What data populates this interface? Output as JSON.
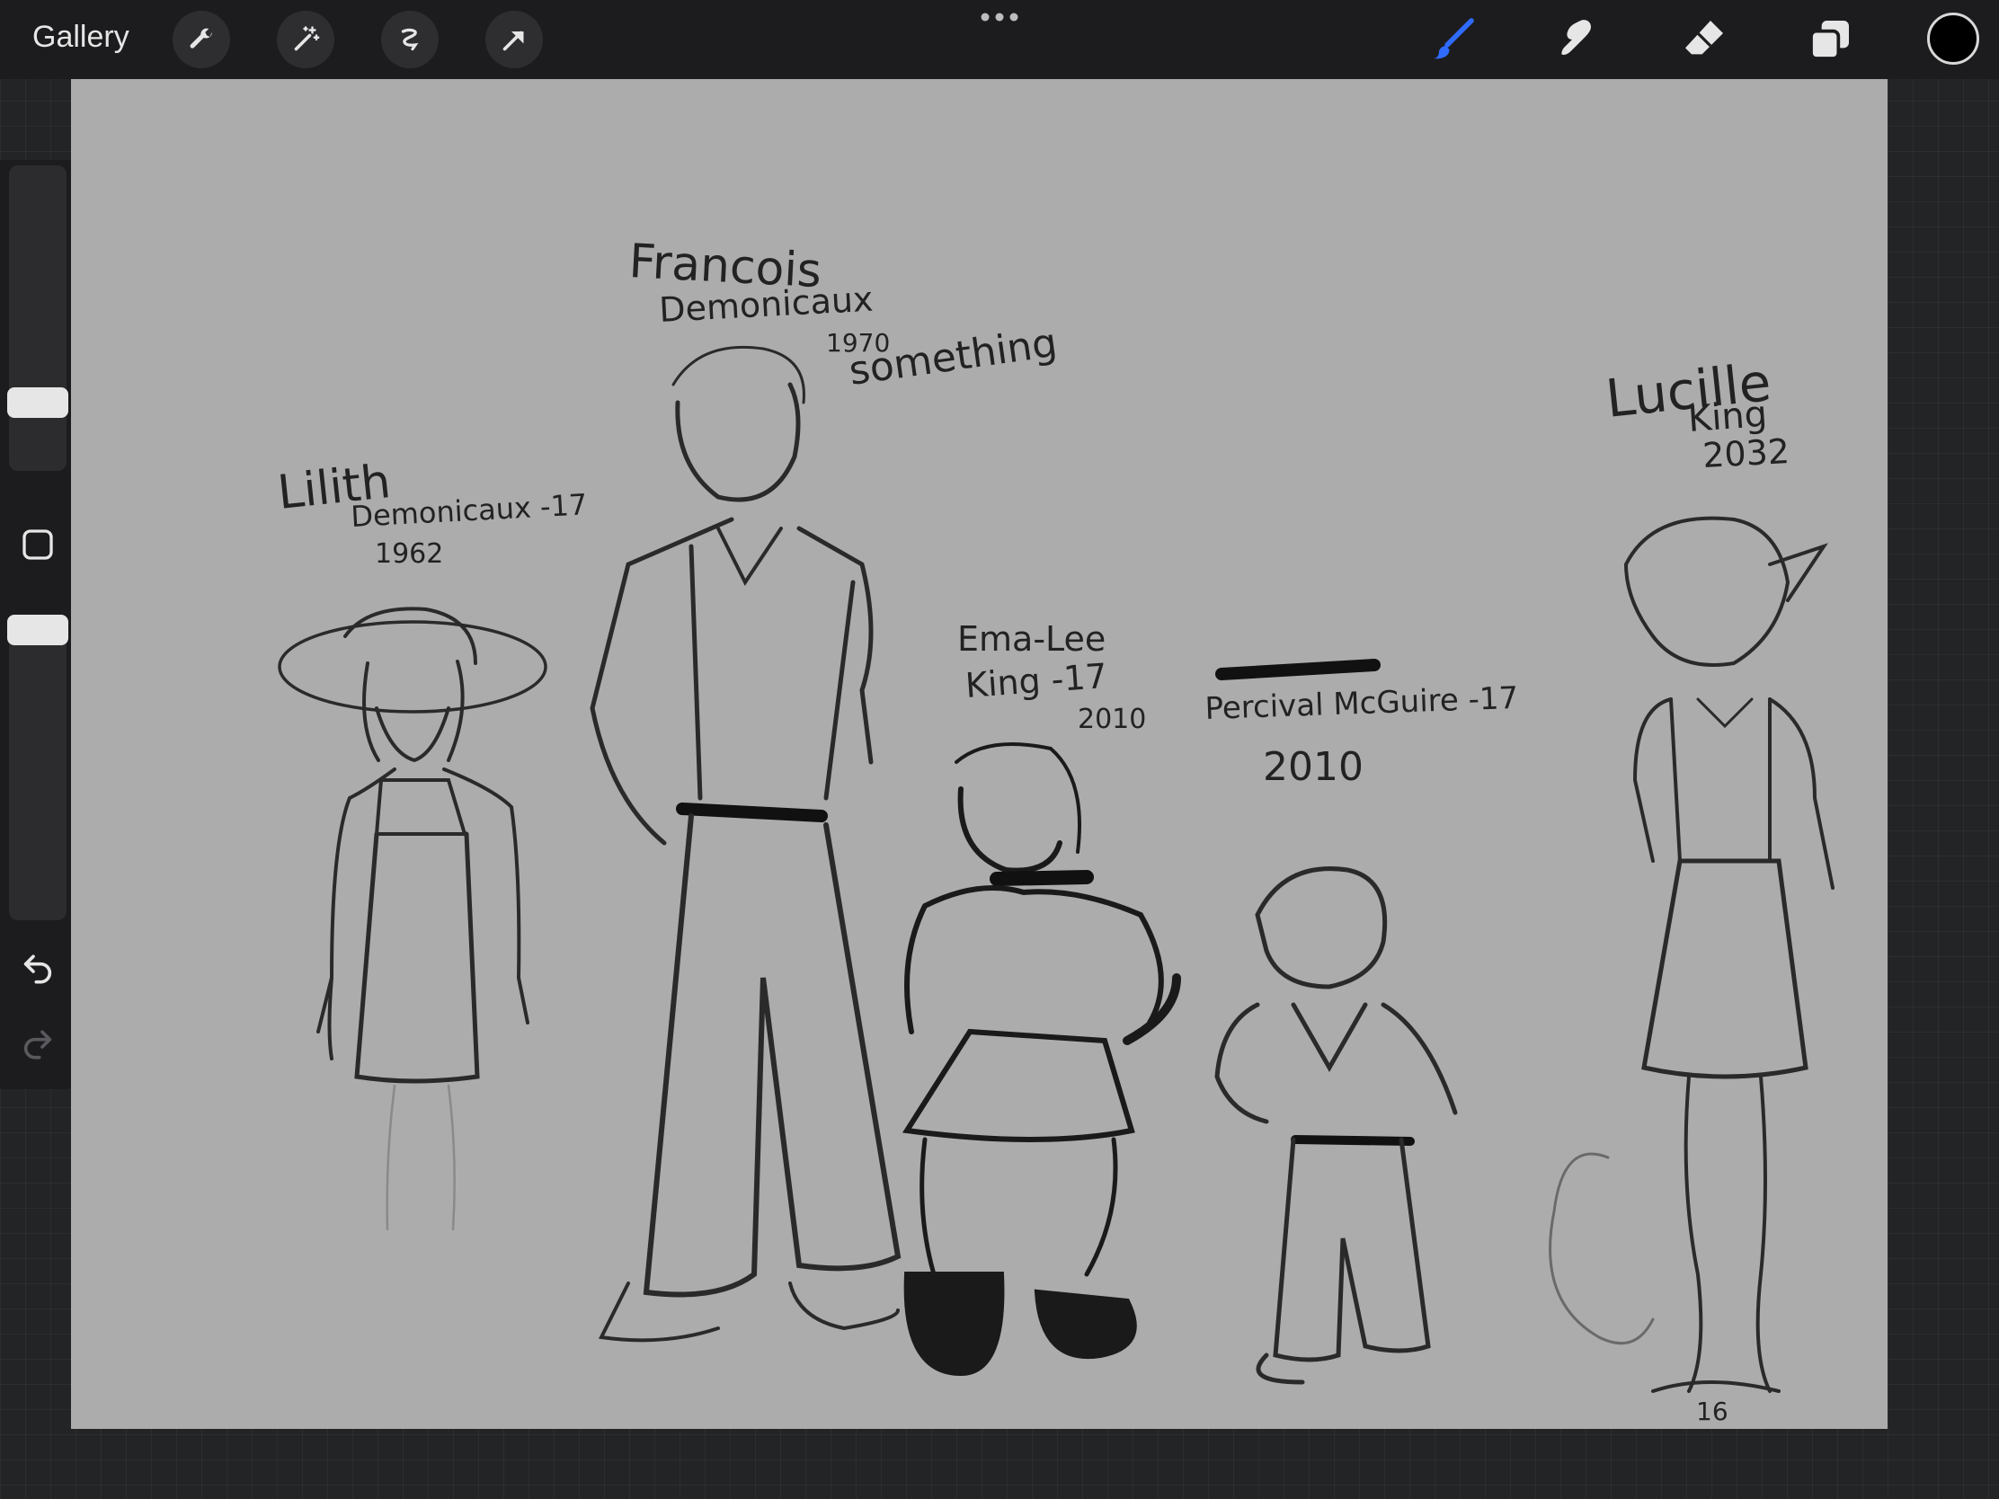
{
  "toolbar": {
    "gallery_label": "Gallery",
    "left_tools": [
      "wrench-icon",
      "magic-wand-icon",
      "selection-icon",
      "transform-arrow-icon"
    ],
    "right_tools": [
      "brush-icon",
      "smudge-icon",
      "eraser-icon",
      "layers-icon"
    ],
    "active_tool": "brush-icon",
    "accent_color": "#2f6bff",
    "current_color": "#000000"
  },
  "sidebar": {
    "size_slider_level": 0.22,
    "opacity_slider_level": 0.22,
    "buttons": [
      "modify-square-icon",
      "undo-icon",
      "redo-icon"
    ],
    "redo_enabled": false
  },
  "canvas": {
    "background": "#acacac",
    "labels": {
      "francois_name": "Francois",
      "francois_surname": "Demonicaux",
      "francois_year": "1970",
      "francois_note": "something",
      "lilith_name": "Lilith",
      "lilith_surname": "Demonicaux -17",
      "lilith_year": "1962",
      "emalee_name": "Ema-Lee",
      "emalee_surname": "King -17",
      "emalee_year": "2010",
      "percival_name": "Percival McGuire -17",
      "percival_year": "2010",
      "lucille_name": "Lucille",
      "lucille_surname": "King",
      "lucille_year": "2032",
      "page_number": "16"
    }
  }
}
